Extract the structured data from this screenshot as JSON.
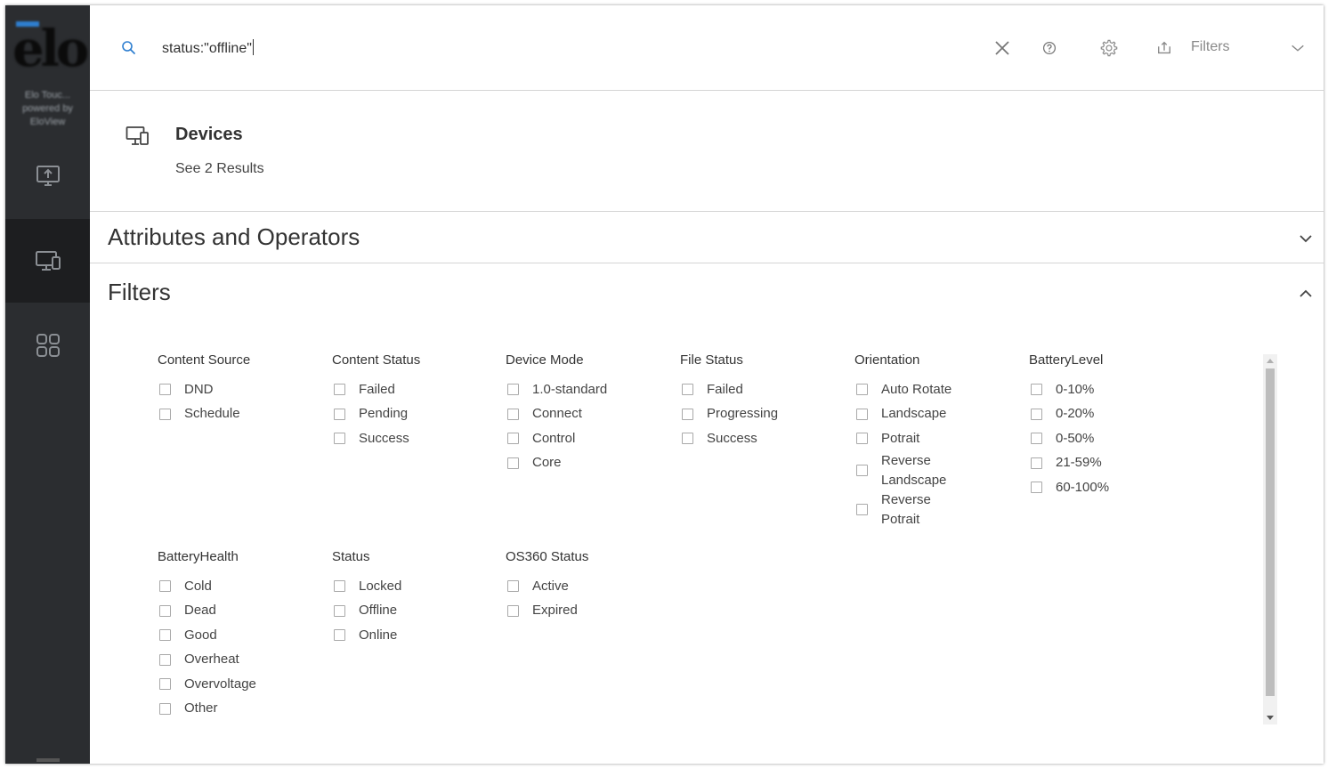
{
  "sidebar": {
    "logo_text": "elo",
    "brand_lines": [
      "Elo Touc...",
      "powered by",
      "EloView"
    ],
    "items": [
      {
        "icon": "upload-screen-icon",
        "active": false
      },
      {
        "icon": "devices-icon",
        "active": true
      },
      {
        "icon": "apps-grid-icon",
        "active": false
      }
    ]
  },
  "search": {
    "icon": "search-icon",
    "query": "status:\"offline\"",
    "clear_icon": "close-icon",
    "help_icon": "help-icon",
    "settings_icon": "gear-icon",
    "export_icon": "export-icon",
    "filters_label": "Filters",
    "expand_icon": "chevron-down-icon"
  },
  "results": {
    "devices_title": "Devices",
    "devices_subtitle": "See 2 Results"
  },
  "sections": {
    "attributes_title": "Attributes and Operators",
    "filters_title": "Filters"
  },
  "filter_groups": [
    {
      "title": "Content Source",
      "options": [
        "DND",
        "Schedule"
      ]
    },
    {
      "title": "Content Status",
      "options": [
        "Failed",
        "Pending",
        "Success"
      ]
    },
    {
      "title": "Device Mode",
      "options": [
        "1.0-standard",
        "Connect",
        "Control",
        "Core"
      ]
    },
    {
      "title": "File Status",
      "options": [
        "Failed",
        "Progressing",
        "Success"
      ]
    },
    {
      "title": "Orientation",
      "options": [
        "Auto Rotate",
        "Landscape",
        "Potrait",
        "Reverse Landscape",
        "Reverse Potrait"
      ]
    },
    {
      "title": "BatteryLevel",
      "options": [
        "0-10%",
        "0-20%",
        "0-50%",
        "21-59%",
        "60-100%"
      ]
    },
    {
      "title": "BatteryHealth",
      "options": [
        "Cold",
        "Dead",
        "Good",
        "Overheat",
        "Overvoltage",
        "Other"
      ]
    },
    {
      "title": "Status",
      "options": [
        "Locked",
        "Offline",
        "Online"
      ]
    },
    {
      "title": "OS360 Status",
      "options": [
        "Active",
        "Expired"
      ]
    }
  ],
  "colors": {
    "sidebar_bg": "#2b2d30",
    "sidebar_active": "#1d1e20",
    "accent": "#2f7fd0"
  }
}
